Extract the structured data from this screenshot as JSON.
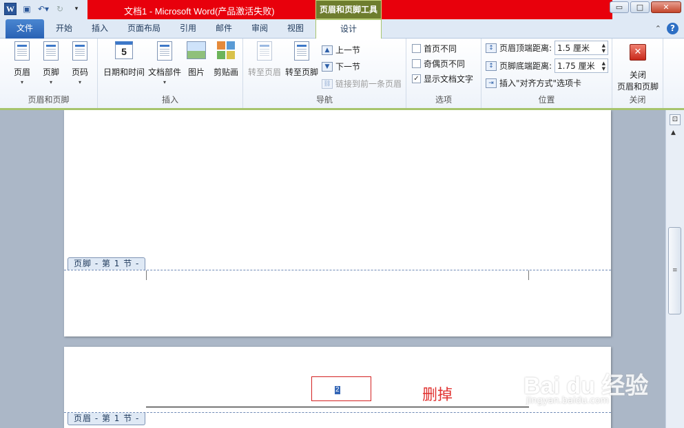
{
  "window": {
    "title": "文档1 - Microsoft Word(产品激活失败)",
    "tool_tab_head": "页眉和页脚工具",
    "controls": [
      "▭",
      "□",
      "✕"
    ]
  },
  "tabs": {
    "file": "文件",
    "items": [
      "开始",
      "插入",
      "页面布局",
      "引用",
      "邮件",
      "审阅",
      "视图"
    ],
    "active": "设计"
  },
  "ribbon": {
    "groups": {
      "hf": {
        "label": "页眉和页脚",
        "buttons": [
          "页眉",
          "页脚",
          "页码"
        ]
      },
      "insert": {
        "label": "插入",
        "buttons": [
          "日期和时间",
          "文档部件",
          "图片",
          "剪贴画"
        ],
        "calendar_digit": "5"
      },
      "nav": {
        "label": "导航",
        "goto_header": "转至页眉",
        "goto_footer": "转至页脚",
        "prev": "上一节",
        "next": "下一节",
        "link_prev": "链接到前一条页眉"
      },
      "options": {
        "label": "选项",
        "first_page": "首页不同",
        "odd_even": "奇偶页不同",
        "show_text": "显示文档文字"
      },
      "position": {
        "label": "位置",
        "header_top": "页眉顶端距离:",
        "header_top_value": "1.5 厘米",
        "footer_bottom": "页脚底端距离:",
        "footer_bottom_value": "1.75 厘米",
        "insert_align": "插入\"对齐方式\"选项卡"
      },
      "close": {
        "label": "关闭",
        "button_line1": "关闭",
        "button_line2": "页眉和页脚"
      }
    }
  },
  "document": {
    "footer_label": "页脚 - 第 1 节 -",
    "header_label": "页眉 - 第 1 节 -",
    "page_number": "2",
    "annotation": "删掉"
  },
  "watermark": {
    "brand": "Bai du 经验",
    "sub": "jingyan.baidu.com"
  },
  "colors": {
    "title_red": "#e8000c",
    "tool_tab_green": "#6e7d2e",
    "annotation_red": "#e0312f"
  }
}
